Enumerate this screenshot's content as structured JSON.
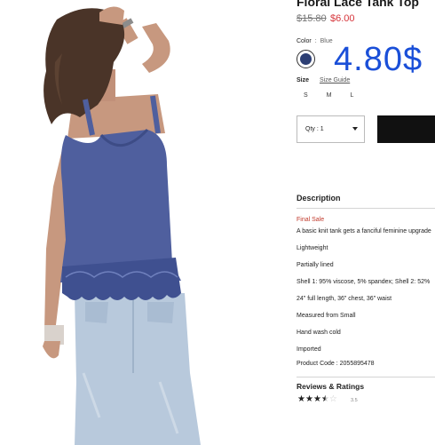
{
  "product": {
    "title": "Floral Lace Tank Top",
    "old_price": "$15.80",
    "new_price": "$6.00",
    "overlay_price": "4.80$"
  },
  "color": {
    "label": "Color",
    "separator": ":",
    "value": "Blue",
    "swatch_hex": "#2d3f74"
  },
  "size": {
    "label": "Size",
    "guide_label": "Size Guide",
    "options": [
      "S",
      "M",
      "L"
    ]
  },
  "quantity": {
    "label": "Qty : 1"
  },
  "description": {
    "heading": "Description",
    "final_sale": "Final Sale",
    "lines": [
      "A basic knit tank gets a fanciful feminine upgrade",
      "Lightweight",
      "Partially lined",
      "Shell 1: 95% viscose, 5% spandex; Shell 2: 52%",
      "24\" full length, 36\" chest, 36\" waist",
      "Measured from Small",
      "Hand wash cold",
      "Imported",
      "Product Code : 2055895478"
    ]
  },
  "reviews": {
    "heading": "Reviews & Ratings",
    "rating": 3.5,
    "rating_text": "3.5",
    "max_stars": 5
  },
  "colors": {
    "sale_red": "#d6343a",
    "overlay_blue": "#1a4fd8",
    "button_black": "#111111"
  }
}
